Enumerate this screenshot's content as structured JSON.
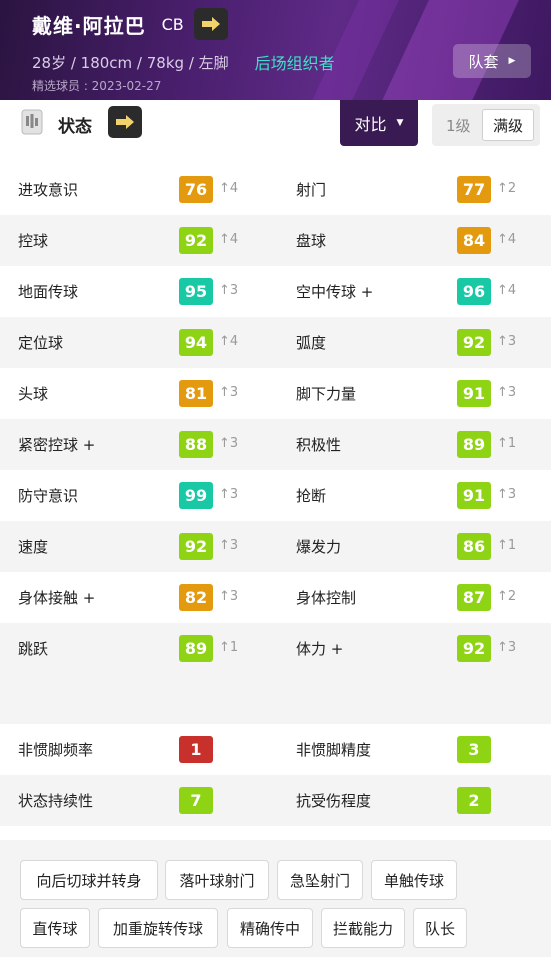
{
  "header": {
    "player_name": "戴维·阿拉巴",
    "position": "CB",
    "physical": "28岁 / 180cm / 78kg / 左脚",
    "role": "后场组织者",
    "featured": "精选球员 : 2023-02-27",
    "kit_label": "队套"
  },
  "toolbar": {
    "status_label": "状态",
    "compare_label": "对比",
    "level_1": "1级",
    "level_max": "满级"
  },
  "attributes": [
    {
      "left": {
        "name": "进攻意识",
        "value": "76",
        "inc": "↑4",
        "color": "#e39a0e"
      },
      "right": {
        "name": "射门",
        "value": "77",
        "inc": "↑2",
        "color": "#e39a0e"
      }
    },
    {
      "left": {
        "name": "控球",
        "value": "92",
        "inc": "↑4",
        "color": "#8fd414"
      },
      "right": {
        "name": "盘球",
        "value": "84",
        "inc": "↑4",
        "color": "#e39a0e"
      }
    },
    {
      "left": {
        "name": "地面传球",
        "value": "95",
        "inc": "↑3",
        "color": "#19c9a6"
      },
      "right": {
        "name": "空中传球 +",
        "value": "96",
        "inc": "↑4",
        "color": "#19c9a6"
      }
    },
    {
      "left": {
        "name": "定位球",
        "value": "94",
        "inc": "↑4",
        "color": "#8fd414"
      },
      "right": {
        "name": "弧度",
        "value": "92",
        "inc": "↑3",
        "color": "#8fd414"
      }
    },
    {
      "left": {
        "name": "头球",
        "value": "81",
        "inc": "↑3",
        "color": "#e39a0e"
      },
      "right": {
        "name": "脚下力量",
        "value": "91",
        "inc": "↑3",
        "color": "#8fd414"
      }
    },
    {
      "left": {
        "name": "紧密控球 +",
        "value": "88",
        "inc": "↑3",
        "color": "#8fd414"
      },
      "right": {
        "name": "积极性",
        "value": "89",
        "inc": "↑1",
        "color": "#8fd414"
      }
    },
    {
      "left": {
        "name": "防守意识",
        "value": "99",
        "inc": "↑3",
        "color": "#19c9a6"
      },
      "right": {
        "name": "抢断",
        "value": "91",
        "inc": "↑3",
        "color": "#8fd414"
      }
    },
    {
      "left": {
        "name": "速度",
        "value": "92",
        "inc": "↑3",
        "color": "#8fd414"
      },
      "right": {
        "name": "爆发力",
        "value": "86",
        "inc": "↑1",
        "color": "#8fd414"
      }
    },
    {
      "left": {
        "name": "身体接触 +",
        "value": "82",
        "inc": "↑3",
        "color": "#e39a0e"
      },
      "right": {
        "name": "身体控制",
        "value": "87",
        "inc": "↑2",
        "color": "#8fd414"
      }
    },
    {
      "left": {
        "name": "跳跃",
        "value": "89",
        "inc": "↑1",
        "color": "#8fd414"
      },
      "right": {
        "name": "体力 +",
        "value": "92",
        "inc": "↑3",
        "color": "#8fd414"
      }
    }
  ],
  "hidden_attributes": [
    {
      "left": {
        "name": "非惯脚频率",
        "value": "1",
        "color": "#c8302b"
      },
      "right": {
        "name": "非惯脚精度",
        "value": "3",
        "color": "#8fd414"
      }
    },
    {
      "left": {
        "name": "状态持续性",
        "value": "7",
        "color": "#8fd414"
      },
      "right": {
        "name": "抗受伤程度",
        "value": "2",
        "color": "#8fd414"
      }
    }
  ],
  "skills": [
    "向后切球并转身",
    "落叶球射门",
    "急坠射门",
    "单触传球",
    "直传球",
    "加重旋转传球",
    "精确传中",
    "拦截能力",
    "队长"
  ]
}
